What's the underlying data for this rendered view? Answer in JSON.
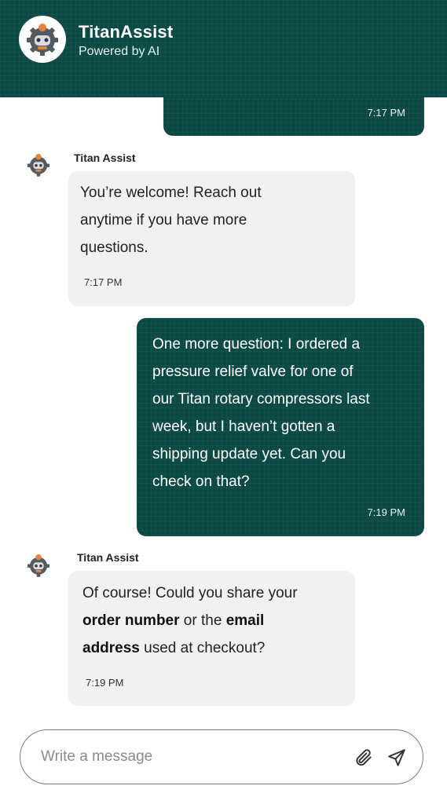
{
  "header": {
    "title": "TitanAssist",
    "subtitle": "Powered by AI",
    "avatar_icon": "robot-icon"
  },
  "messages": [
    {
      "role": "user",
      "text": "",
      "time": "7:17 PM"
    },
    {
      "role": "bot",
      "sender": "Titan Assist",
      "lines": [
        "You’re welcome! Reach out",
        "anytime if you have more",
        "questions."
      ],
      "time": "7:17 PM"
    },
    {
      "role": "user",
      "lines": [
        "One more question: I ordered a",
        "pressure relief valve for one of",
        "our Titan rotary compressors last",
        "week, but I haven’t gotten a",
        "shipping update yet. Can you",
        "check on that?"
      ],
      "time": "7:19 PM"
    },
    {
      "role": "bot",
      "sender": "Titan Assist",
      "line1": "Of course! Could you share your",
      "line2_bold_a": "order number",
      "line2_mid": " or the ",
      "line2_bold_b": "email",
      "line3_bold": "address",
      "line3_rest": " used at checkout?",
      "time": "7:19 PM"
    }
  ],
  "composer": {
    "placeholder": "Write a message",
    "attach_icon": "paperclip-icon",
    "send_icon": "send-icon"
  },
  "colors": {
    "brand": "#0b4a44",
    "bot_bubble": "#f1f1f1"
  }
}
